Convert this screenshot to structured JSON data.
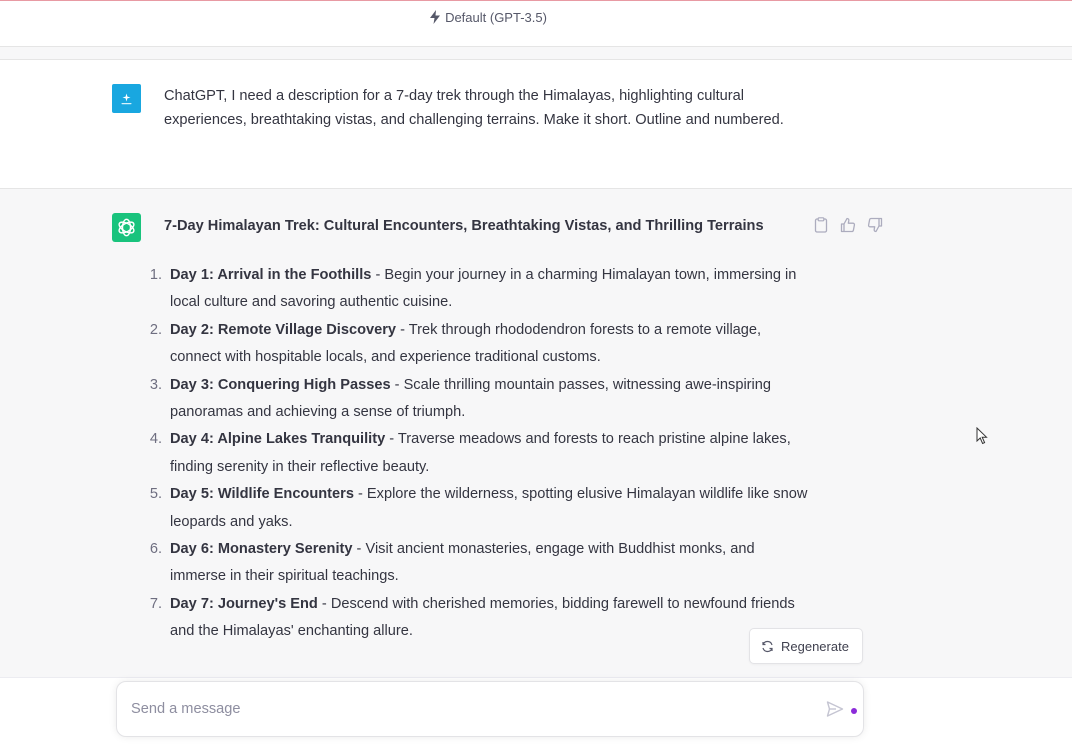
{
  "header": {
    "model_label": "Default (GPT-3.5)"
  },
  "user_message": {
    "text": "ChatGPT, I need a description for a 7-day trek through the Himalayas, highlighting cultural experiences, breathtaking vistas, and challenging terrains. Make it short. Outline and numbered."
  },
  "assistant_message": {
    "title": "7-Day Himalayan Trek: Cultural Encounters, Breathtaking Vistas, and Thrilling Terrains",
    "items": [
      {
        "num": "1.",
        "day": "Day 1: Arrival in the Foothills",
        "text": " - Begin your journey in a charming Himalayan town, immersing in local culture and savoring authentic cuisine."
      },
      {
        "num": "2.",
        "day": "Day 2: Remote Village Discovery",
        "text": " - Trek through rhododendron forests to a remote village, connect with hospitable locals, and experience traditional customs."
      },
      {
        "num": "3.",
        "day": "Day 3: Conquering High Passes",
        "text": " - Scale thrilling mountain passes, witnessing awe-inspiring panoramas and achieving a sense of triumph."
      },
      {
        "num": "4.",
        "day": "Day 4: Alpine Lakes Tranquility",
        "text": " - Traverse meadows and forests to reach pristine alpine lakes, finding serenity in their reflective beauty."
      },
      {
        "num": "5.",
        "day": "Day 5: Wildlife Encounters",
        "text": " - Explore the wilderness, spotting elusive Himalayan wildlife like snow leopards and yaks."
      },
      {
        "num": "6.",
        "day": "Day 6: Monastery Serenity",
        "text": " - Visit ancient monasteries, engage with Buddhist monks, and immerse in their spiritual teachings."
      },
      {
        "num": "7.",
        "day": "Day 7: Journey's End",
        "text": " - Descend with cherished memories, bidding farewell to newfound friends and the Himalayas' enchanting allure."
      }
    ]
  },
  "actions": {
    "regenerate_label": "Regenerate"
  },
  "composer": {
    "placeholder": "Send a message",
    "value": ""
  },
  "colors": {
    "gpt_avatar": "#19c37d",
    "user_avatar": "#19a7e0",
    "assistant_bg": "#f7f7f8",
    "text": "#343541",
    "typing_dot": "#8b2bd9"
  },
  "icons": {
    "model": "lightning-bolt-icon",
    "gpt": "openai-logo-icon",
    "copy": "clipboard-icon",
    "like": "thumbs-up-icon",
    "dislike": "thumbs-down-icon",
    "regenerate": "refresh-icon",
    "send": "paper-plane-icon"
  }
}
